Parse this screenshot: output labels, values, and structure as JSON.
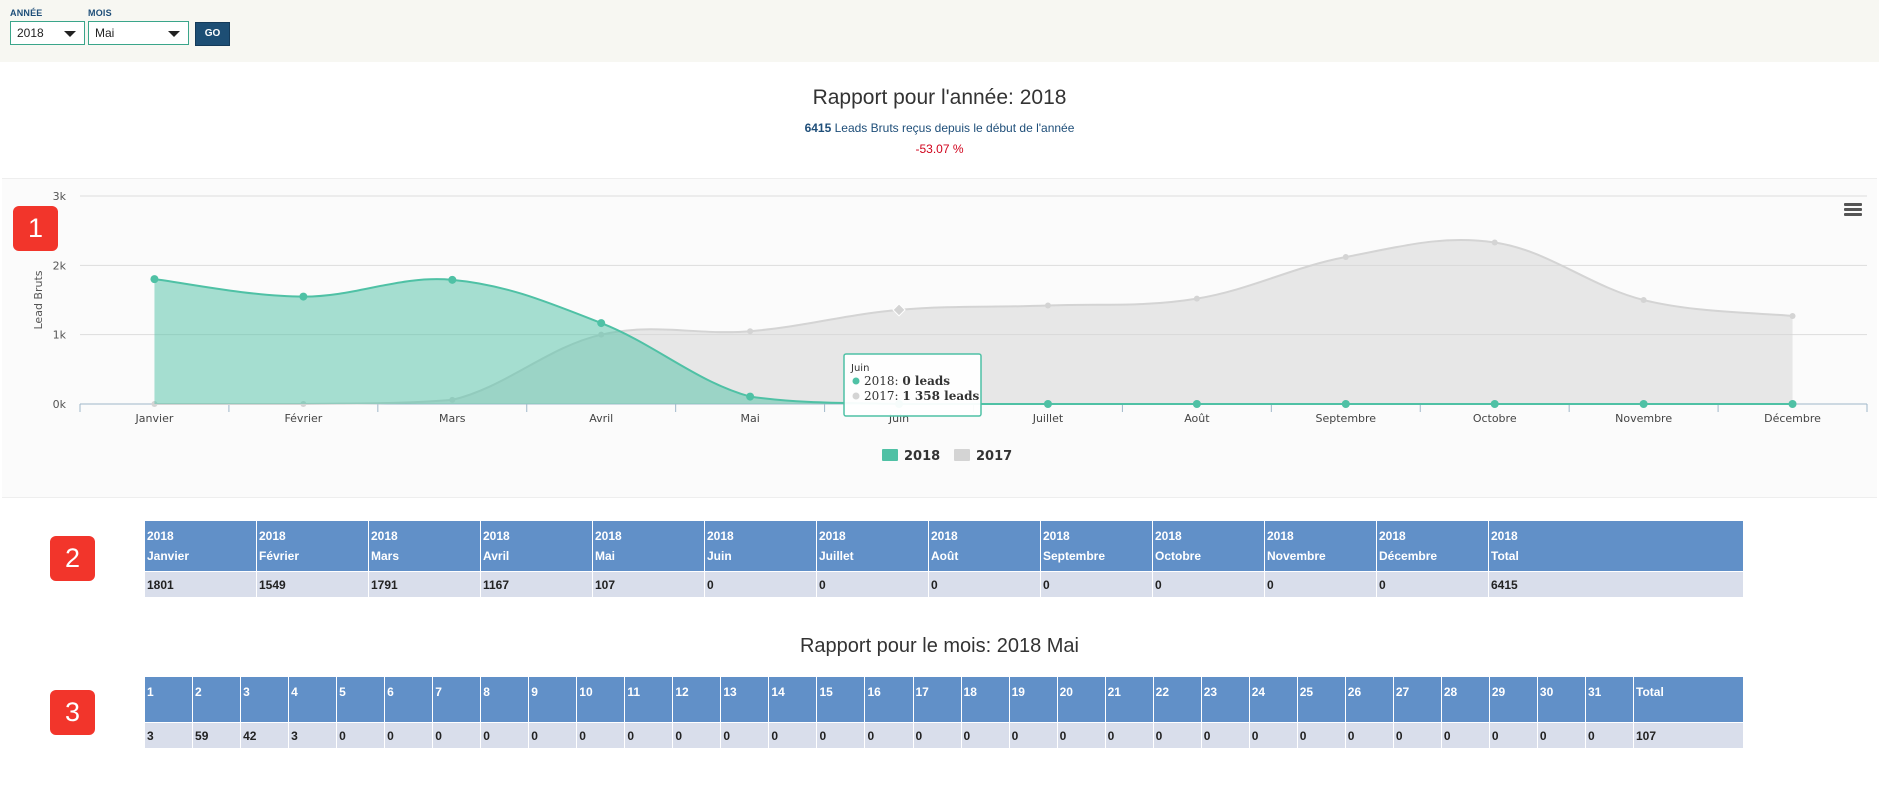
{
  "filters": {
    "year_label": "ANNÉE",
    "year_value": "2018",
    "month_label": "MOIS",
    "month_value": "Mai",
    "go_label": "GO"
  },
  "header": {
    "title": "Rapport pour l'année: 2018",
    "leads_count": "6415",
    "leads_text": " Leads Bruts reçus depuis le début de l'année",
    "percent": "-53.07 %"
  },
  "badges": [
    "1",
    "2",
    "3"
  ],
  "chart_data": {
    "type": "area",
    "categories": [
      "Janvier",
      "Février",
      "Mars",
      "Avril",
      "Mai",
      "Juin",
      "Juillet",
      "Août",
      "Septembre",
      "Octobre",
      "Novembre",
      "Décembre"
    ],
    "ylabel": "Lead Bruts",
    "yticks": [
      "0k",
      "1k",
      "2k",
      "3k"
    ],
    "ylim": [
      0,
      3000
    ],
    "series": [
      {
        "name": "2018",
        "color": "#4fc1a5",
        "values": [
          1801,
          1549,
          1791,
          1167,
          107,
          0,
          0,
          0,
          0,
          0,
          0,
          0
        ]
      },
      {
        "name": "2017",
        "color": "#d4d4d4",
        "values": [
          0,
          0,
          60,
          1000,
          1050,
          1358,
          1420,
          1520,
          2120,
          2330,
          1500,
          1270
        ]
      }
    ],
    "tooltip": {
      "title": "Juin",
      "line1_label": "2018: ",
      "line1_value": "0 leads",
      "line2_label": "2017: ",
      "line2_value": "1 358 leads"
    },
    "legend_position": "bottom-center"
  },
  "year_table": {
    "headers": [
      [
        "2018",
        "Janvier"
      ],
      [
        "2018",
        "Février"
      ],
      [
        "2018",
        "Mars"
      ],
      [
        "2018",
        "Avril"
      ],
      [
        "2018",
        "Mai"
      ],
      [
        "2018",
        "Juin"
      ],
      [
        "2018",
        "Juillet"
      ],
      [
        "2018",
        "Août"
      ],
      [
        "2018",
        "Septembre"
      ],
      [
        "2018",
        "Octobre"
      ],
      [
        "2018",
        "Novembre"
      ],
      [
        "2018",
        "Décembre"
      ],
      [
        "2018",
        "Total"
      ]
    ],
    "values": [
      "1801",
      "1549",
      "1791",
      "1167",
      "107",
      "0",
      "0",
      "0",
      "0",
      "0",
      "0",
      "0",
      "6415"
    ]
  },
  "month_report": {
    "title": "Rapport pour le mois: 2018 Mai",
    "headers": [
      "1",
      "2",
      "3",
      "4",
      "5",
      "6",
      "7",
      "8",
      "9",
      "10",
      "11",
      "12",
      "13",
      "14",
      "15",
      "16",
      "17",
      "18",
      "19",
      "20",
      "21",
      "22",
      "23",
      "24",
      "25",
      "26",
      "27",
      "28",
      "29",
      "30",
      "31",
      "Total"
    ],
    "values": [
      "3",
      "59",
      "42",
      "3",
      "0",
      "0",
      "0",
      "0",
      "0",
      "0",
      "0",
      "0",
      "0",
      "0",
      "0",
      "0",
      "0",
      "0",
      "0",
      "0",
      "0",
      "0",
      "0",
      "0",
      "0",
      "0",
      "0",
      "0",
      "0",
      "0",
      "0",
      "107"
    ]
  }
}
